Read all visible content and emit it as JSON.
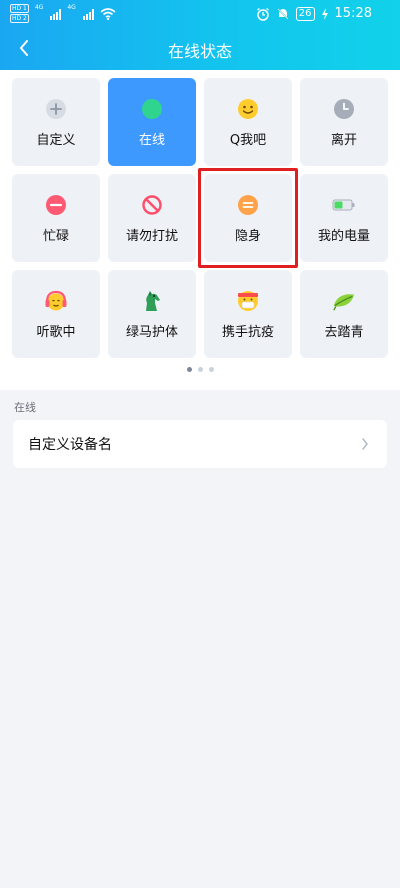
{
  "status_bar": {
    "hd1": "HD 1",
    "hd2": "HD 2",
    "net1": "4G",
    "net2": "4G",
    "battery": "26",
    "time": "15:28"
  },
  "header": {
    "title": "在线状态"
  },
  "statuses": [
    {
      "label": "自定义",
      "icon": "plus-icon",
      "selected": false,
      "highlight": false
    },
    {
      "label": "在线",
      "icon": "online-dot-icon",
      "selected": true,
      "highlight": false
    },
    {
      "label": "Q我吧",
      "icon": "smile-icon",
      "selected": false,
      "highlight": false
    },
    {
      "label": "离开",
      "icon": "clock-icon",
      "selected": false,
      "highlight": false
    },
    {
      "label": "忙碌",
      "icon": "busy-icon",
      "selected": false,
      "highlight": false
    },
    {
      "label": "请勿打扰",
      "icon": "do-not-disturb-icon",
      "selected": false,
      "highlight": false
    },
    {
      "label": "隐身",
      "icon": "invisible-icon",
      "selected": false,
      "highlight": true
    },
    {
      "label": "我的电量",
      "icon": "battery-icon",
      "selected": false,
      "highlight": false
    },
    {
      "label": "听歌中",
      "icon": "headphones-icon",
      "selected": false,
      "highlight": false
    },
    {
      "label": "绿马护体",
      "icon": "green-horse-icon",
      "selected": false,
      "highlight": false
    },
    {
      "label": "携手抗疫",
      "icon": "mask-icon",
      "selected": false,
      "highlight": false
    },
    {
      "label": "去踏青",
      "icon": "leaf-icon",
      "selected": false,
      "highlight": false
    }
  ],
  "pager": {
    "count": 3,
    "active": 0
  },
  "section": {
    "label": "在线",
    "item": "自定义设备名"
  },
  "colors": {
    "accent": "#3e99ff",
    "highlight_border": "#e02020"
  }
}
